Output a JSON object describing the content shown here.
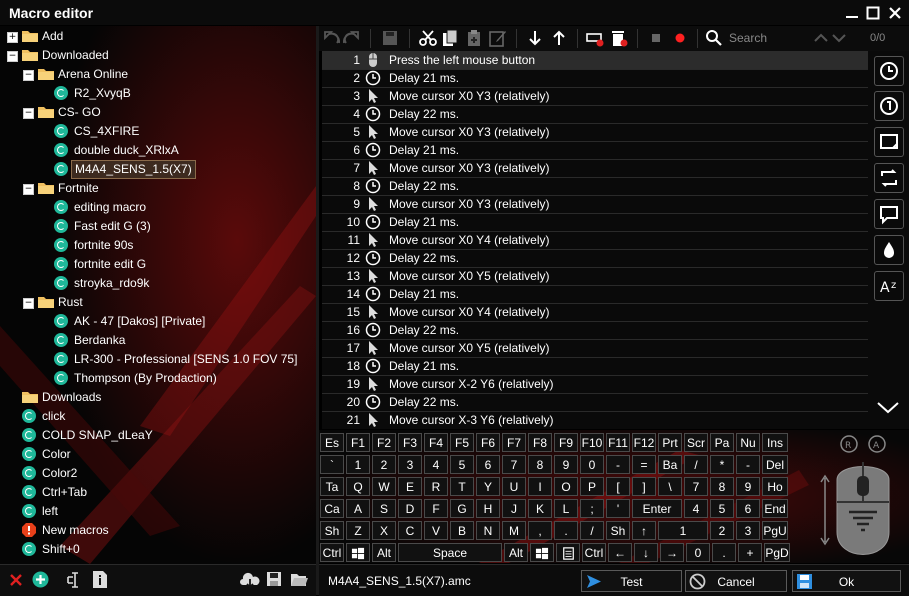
{
  "window": {
    "title": "Macro editor"
  },
  "tree": [
    {
      "label": "Add",
      "type": "folder",
      "level": 0,
      "expander": "+"
    },
    {
      "label": "Downloaded",
      "type": "folder",
      "level": 0,
      "expander": "−"
    },
    {
      "label": "Arena Online",
      "type": "folder",
      "level": 1,
      "expander": "−"
    },
    {
      "label": "R2_XvyqB",
      "type": "macro",
      "level": 2
    },
    {
      "label": "CS- GO",
      "type": "folder",
      "level": 1,
      "expander": "−"
    },
    {
      "label": "CS_4XFIRE",
      "type": "macro",
      "level": 2
    },
    {
      "label": "double duck_XRlxA",
      "type": "macro",
      "level": 2
    },
    {
      "label": "M4A4_SENS_1.5(X7)",
      "type": "macro",
      "level": 2,
      "selected": true
    },
    {
      "label": "Fortnite",
      "type": "folder",
      "level": 1,
      "expander": "−"
    },
    {
      "label": "editing macro",
      "type": "macro",
      "level": 2
    },
    {
      "label": "Fast edit G (3)",
      "type": "macro",
      "level": 2
    },
    {
      "label": "fortnite 90s",
      "type": "macro",
      "level": 2
    },
    {
      "label": "fortnite edit G",
      "type": "macro",
      "level": 2
    },
    {
      "label": "stroyka_rdo9k",
      "type": "macro",
      "level": 2
    },
    {
      "label": "Rust",
      "type": "folder",
      "level": 1,
      "expander": "−"
    },
    {
      "label": "AK - 47 [Dakos] [Private]",
      "type": "macro",
      "level": 2
    },
    {
      "label": "Berdanka",
      "type": "macro",
      "level": 2
    },
    {
      "label": "LR-300 - Professional [SENS 1.0 FOV 75]",
      "type": "macro",
      "level": 2
    },
    {
      "label": "Thompson (By Prodaction)",
      "type": "macro",
      "level": 2
    },
    {
      "label": "Downloads",
      "type": "folder",
      "level": 0
    },
    {
      "label": "click",
      "type": "macro",
      "level": 0
    },
    {
      "label": "COLD SNAP_dLeaY",
      "type": "macro",
      "level": 0
    },
    {
      "label": "Color",
      "type": "macro",
      "level": 0
    },
    {
      "label": "Color2",
      "type": "macro",
      "level": 0
    },
    {
      "label": "Ctrl+Tab",
      "type": "macro",
      "level": 0
    },
    {
      "label": "left",
      "type": "macro",
      "level": 0
    },
    {
      "label": "New macros",
      "type": "warning",
      "level": 0
    },
    {
      "label": "Shift+0",
      "type": "macro",
      "level": 0
    }
  ],
  "search": {
    "placeholder": "Search",
    "count": "0/0"
  },
  "steps": [
    {
      "n": "1",
      "icon": "mouse-icon",
      "text": "Press the left mouse button"
    },
    {
      "n": "2",
      "icon": "clock-icon",
      "text": "Delay 21 ms."
    },
    {
      "n": "3",
      "icon": "cursor-icon",
      "text": "Move cursor X0 Y3 (relatively)"
    },
    {
      "n": "4",
      "icon": "clock-icon",
      "text": "Delay 22 ms."
    },
    {
      "n": "5",
      "icon": "cursor-icon",
      "text": "Move cursor X0 Y3 (relatively)"
    },
    {
      "n": "6",
      "icon": "clock-icon",
      "text": "Delay 21 ms."
    },
    {
      "n": "7",
      "icon": "cursor-icon",
      "text": "Move cursor X0 Y3 (relatively)"
    },
    {
      "n": "8",
      "icon": "clock-icon",
      "text": "Delay 22 ms."
    },
    {
      "n": "9",
      "icon": "cursor-icon",
      "text": "Move cursor X0 Y3 (relatively)"
    },
    {
      "n": "10",
      "icon": "clock-icon",
      "text": "Delay 21 ms."
    },
    {
      "n": "11",
      "icon": "cursor-icon",
      "text": "Move cursor X0 Y4 (relatively)"
    },
    {
      "n": "12",
      "icon": "clock-icon",
      "text": "Delay 22 ms."
    },
    {
      "n": "13",
      "icon": "cursor-icon",
      "text": "Move cursor X0 Y5 (relatively)"
    },
    {
      "n": "14",
      "icon": "clock-icon",
      "text": "Delay 21 ms."
    },
    {
      "n": "15",
      "icon": "cursor-icon",
      "text": "Move cursor X0 Y4 (relatively)"
    },
    {
      "n": "16",
      "icon": "clock-icon",
      "text": "Delay 22 ms."
    },
    {
      "n": "17",
      "icon": "cursor-icon",
      "text": "Move cursor X0 Y5 (relatively)"
    },
    {
      "n": "18",
      "icon": "clock-icon",
      "text": "Delay 21 ms."
    },
    {
      "n": "19",
      "icon": "cursor-icon",
      "text": "Move cursor X-2 Y6 (relatively)"
    },
    {
      "n": "20",
      "icon": "clock-icon",
      "text": "Delay 22 ms."
    },
    {
      "n": "21",
      "icon": "cursor-icon",
      "text": "Move cursor X-3 Y6 (relatively)"
    }
  ],
  "keyboard_rows": [
    [
      "Es",
      "F1",
      "F2",
      "F3",
      "F4",
      "F5",
      "F6",
      "F7",
      "F8",
      "F9",
      "F10",
      "F11",
      "F12",
      "Prt",
      "Scr",
      "Pa",
      "Nu",
      "Ins"
    ],
    [
      "`",
      "1",
      "2",
      "3",
      "4",
      "5",
      "6",
      "7",
      "8",
      "9",
      "0",
      "-",
      "=",
      "Ba",
      "/",
      "*",
      "-",
      "Del"
    ],
    [
      "Ta",
      "Q",
      "W",
      "E",
      "R",
      "T",
      "Y",
      "U",
      "I",
      "O",
      "P",
      "[",
      "]",
      "\\",
      "7",
      "8",
      "9",
      "Ho"
    ],
    [
      "Ca",
      "A",
      "S",
      "D",
      "F",
      "G",
      "H",
      "J",
      "K",
      "L",
      ";",
      "'",
      "Enter",
      "4",
      "5",
      "6",
      "End"
    ],
    [
      "Sh",
      "Z",
      "X",
      "C",
      "V",
      "B",
      "N",
      "M",
      ",",
      ".",
      "/",
      "Sh",
      "↑",
      "1",
      "2",
      "3",
      "PgU"
    ],
    [
      "Ctrl",
      "win",
      "Alt",
      "Space",
      "Alt",
      "win",
      "menu",
      "Ctrl",
      "←",
      "↓",
      "→",
      "0",
      ".",
      "+",
      "PgD"
    ]
  ],
  "bottom": {
    "filename": "M4A4_SENS_1.5(X7).amc",
    "test": "Test",
    "cancel": "Cancel",
    "ok": "Ok"
  },
  "colors": {
    "accent": "#ff2a2a",
    "macro": "#1fb89a",
    "folder": "#f0c060"
  }
}
